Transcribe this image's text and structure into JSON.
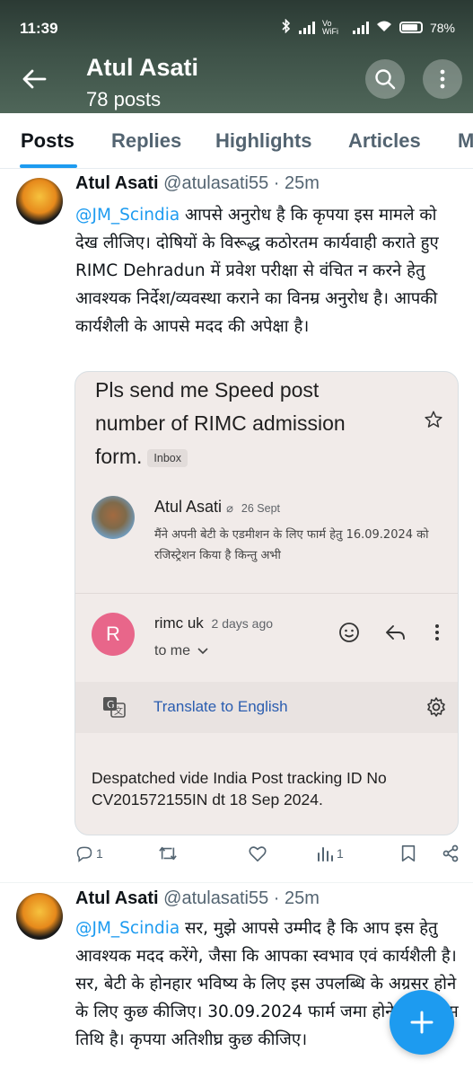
{
  "status_bar": {
    "time": "11:39",
    "battery": "78%",
    "network": "Vo WiFi"
  },
  "header": {
    "name": "Atul Asati",
    "posts": "78 posts"
  },
  "tabs": [
    {
      "label": "Posts",
      "active": true
    },
    {
      "label": "Replies"
    },
    {
      "label": "Highlights"
    },
    {
      "label": "Articles"
    },
    {
      "label": "M"
    }
  ],
  "tweets": [
    {
      "author": "Atul Asati",
      "handle": "@atulasati55",
      "time": "· 25m",
      "mention": "@JM_Scindia",
      "text": " आपसे अनुरोध है कि कृपया इस मामले को देख लीजिए। दोषियों के विरूद्ध कठोरतम कार्यवाही कराते हुए RIMC Dehradun में प्रवेश परीक्षा से वंचित न करने हेतु आवश्यक निर्देश/व्यवस्था कराने का विनम्र अनुरोध है। आपकी कार्यशैली के आपसे मदद की अपेक्षा है।",
      "email": {
        "subject": "Pls send me Speed post number of RIMC admission form.",
        "label": "Inbox",
        "first_sender": "Atul Asati",
        "first_date": "26 Sept",
        "first_snippet": "मैंने अपनी बेटी के एडमीशन के लिए फार्म हेतु 16.09.2024 को रजिस्ट्रेशन किया है किन्तु अभी",
        "reply_initial": "R",
        "reply_sender": "rimc uk",
        "reply_date": "2 days ago",
        "reply_to": "to me",
        "translate": "Translate to English",
        "body": "Despatched vide India Post tracking ID No CV201572155IN dt 18 Sep 2024."
      },
      "stats": {
        "replies": "1",
        "retweets": "",
        "likes": "",
        "views": "1"
      }
    },
    {
      "author": "Atul Asati",
      "handle": "@atulasati55",
      "time": "· 25m",
      "mention": "@JM_Scindia",
      "text": " सर, मुझे आपसे उम्मीद है कि आप इस हेतु आवश्यक मदद करेंगे, जैसा कि आपका स्वभाव एवं कार्यशैली है। सर, बेटी के होनहार भविष्य के लिए इस उपलब्धि के अग्रसर होने के लिए कुछ कीजिए। 30.09.2024 फार्म जमा होने की अंतिम तिथि है। कृपया अतिशीघ्र कुछ कीजिए।"
    }
  ],
  "colors": {
    "accent": "#1d9bf0",
    "text": "#0f1419",
    "secondary": "#536471",
    "reply_avatar": "#e8668a"
  }
}
